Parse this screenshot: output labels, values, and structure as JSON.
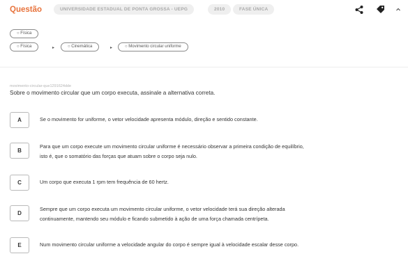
{
  "header": {
    "title": "Questão",
    "chips": [
      "UNIVERSIDADE ESTADUAL DE PONTA GROSSA - UEPG",
      "2010",
      "FASE ÚNICA"
    ],
    "icons": [
      "share-icon",
      "tag-icon",
      "chevron-up-icon"
    ]
  },
  "tags": {
    "subject": "Física",
    "path": [
      "Física",
      "Cinemática",
      "Movimento circular uniforme"
    ]
  },
  "question": {
    "id": "movimento-circular-que1291624dde",
    "statement": "Sobre o movimento circular que um corpo executa, assinale a alternativa correta.",
    "options": [
      {
        "letter": "A",
        "text": "Se o movimento for uniforme, o vetor velocidade apresenta módulo, direção e sentido constante."
      },
      {
        "letter": "B",
        "line1": "Para que um corpo execute um movimento circular uniforme é necessário observar a primeira condição de equilíbrio,",
        "line2": "isto é, que o somatório das forças que atuam sobre o corpo seja nulo."
      },
      {
        "letter": "C",
        "text": "Um corpo que executa 1 rpm tem frequência de 60 hertz."
      },
      {
        "letter": "D",
        "line1": "Sempre que um corpo executa um movimento circular uniforme, o vetor velocidade terá sua direção alterada",
        "line2": "continuamente, mantendo seu módulo e ficando submetido à ação de uma força chamada centrípeta."
      },
      {
        "letter": "E",
        "text": "Num movimento circular uniforme a velocidade angular do corpo é sempre igual à velocidade escalar desse corpo."
      }
    ]
  },
  "colors": {
    "accent": "#e8733c",
    "chip_bg": "#efefef",
    "chip_text": "#a9a9a9"
  }
}
